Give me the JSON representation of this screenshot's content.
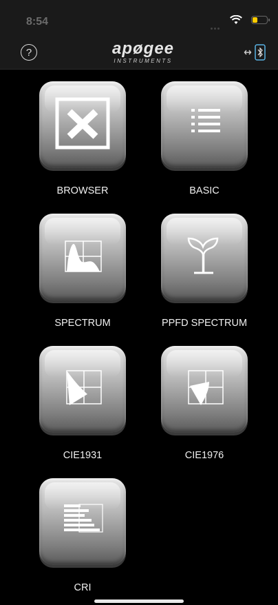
{
  "status_bar": {
    "time": "8:54"
  },
  "nav": {
    "logo_main": "apøgee",
    "logo_sub": "INSTRUMENTS"
  },
  "apps": [
    {
      "label": "BROWSER",
      "icon": "excel-icon"
    },
    {
      "label": "BASIC",
      "icon": "list-icon"
    },
    {
      "label": "SPECTRUM",
      "icon": "spectrum-graph-icon"
    },
    {
      "label": "PPFD SPECTRUM",
      "icon": "plant-sprout-icon"
    },
    {
      "label": "CIE1931",
      "icon": "cie1931-chart-icon"
    },
    {
      "label": "CIE1976",
      "icon": "cie1976-chart-icon"
    },
    {
      "label": "CRI",
      "icon": "cri-bars-icon"
    }
  ],
  "colors": {
    "battery": "#ffcc00",
    "background": "#000000"
  }
}
